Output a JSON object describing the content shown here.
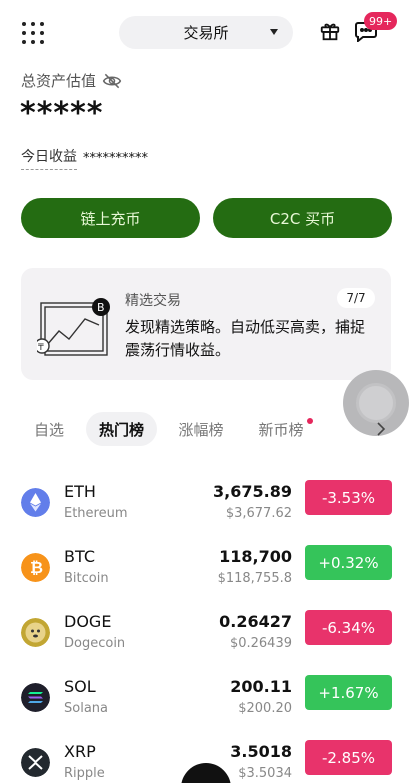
{
  "header": {
    "exchange_label": "交易所",
    "badge": "99+"
  },
  "asset": {
    "label": "总资产估值",
    "value": "*****",
    "pnl_label": "今日收益",
    "pnl_value": "**********"
  },
  "actions": {
    "onchain_deposit": "链上充币",
    "c2c_buy": "C2C 买币"
  },
  "promo": {
    "title": "精选交易",
    "text": "发现精选策略。自动低买高卖，捕捉震荡行情收益。",
    "page": "7/7"
  },
  "tabs": [
    {
      "label": "自选"
    },
    {
      "label": "热门榜"
    },
    {
      "label": "涨幅榜"
    },
    {
      "label": "新币榜"
    }
  ],
  "coins": [
    {
      "symbol": "ETH",
      "name": "Ethereum",
      "price": "3,675.89",
      "usd": "$3,677.62",
      "change": "-3.53%",
      "direction": "down",
      "icon_color": "#627eea"
    },
    {
      "symbol": "BTC",
      "name": "Bitcoin",
      "price": "118,700",
      "usd": "$118,755.8",
      "change": "+0.32%",
      "direction": "up",
      "icon_color": "#f7931a"
    },
    {
      "symbol": "DOGE",
      "name": "Dogecoin",
      "price": "0.26427",
      "usd": "$0.26439",
      "change": "-6.34%",
      "direction": "down",
      "icon_color": "#c2a633"
    },
    {
      "symbol": "SOL",
      "name": "Solana",
      "price": "200.11",
      "usd": "$200.20",
      "change": "+1.67%",
      "direction": "up",
      "icon_color": "#1f1f2b"
    },
    {
      "symbol": "XRP",
      "name": "Ripple",
      "price": "3.5018",
      "usd": "$3.5034",
      "change": "-2.85%",
      "direction": "down",
      "icon_color": "#23292f"
    }
  ],
  "colors": {
    "primary_green": "#246c12",
    "up": "#35c45a",
    "down": "#e8336b",
    "badge": "#e5275c"
  }
}
